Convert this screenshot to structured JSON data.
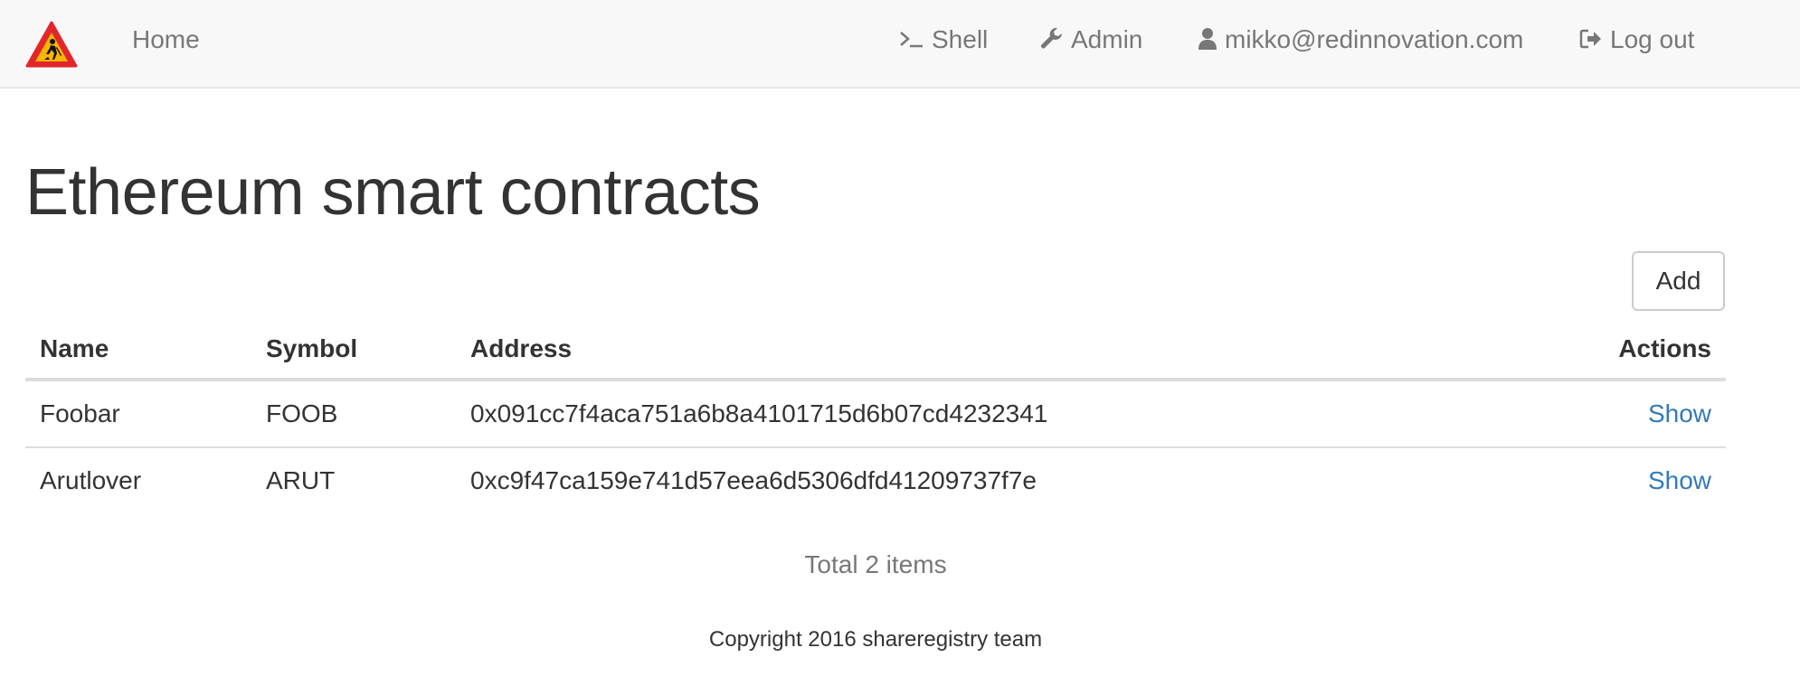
{
  "navbar": {
    "logo_icon": "construction-warning-icon",
    "home_label": "Home",
    "shell_label": "Shell",
    "admin_label": "Admin",
    "user_label": "mikko@redinnovation.com",
    "logout_label": "Log out",
    "icons": {
      "shell": "terminal-icon",
      "admin": "wrench-icon",
      "user": "user-icon",
      "logout": "log-out-icon"
    }
  },
  "page": {
    "title": "Ethereum smart contracts",
    "add_label": "Add"
  },
  "table": {
    "headers": {
      "name": "Name",
      "symbol": "Symbol",
      "address": "Address",
      "actions": "Actions"
    },
    "rows": [
      {
        "name": "Foobar",
        "symbol": "FOOB",
        "address": "0x091cc7f4aca751a6b8a4101715d6b07cd4232341",
        "action": "Show"
      },
      {
        "name": "Arutlover",
        "symbol": "ARUT",
        "address": "0xc9f47ca159e741d57eea6d5306dfd41209737f7e",
        "action": "Show"
      }
    ]
  },
  "summary": {
    "total_text": "Total 2 items"
  },
  "footer": {
    "copyright": "Copyright 2016 shareregistry team"
  },
  "colors": {
    "navbar_bg": "#f8f8f8",
    "link": "#337ab7",
    "nav_text": "#777777",
    "warning_red": "#e3262b",
    "warning_yellow": "#f7b500"
  }
}
